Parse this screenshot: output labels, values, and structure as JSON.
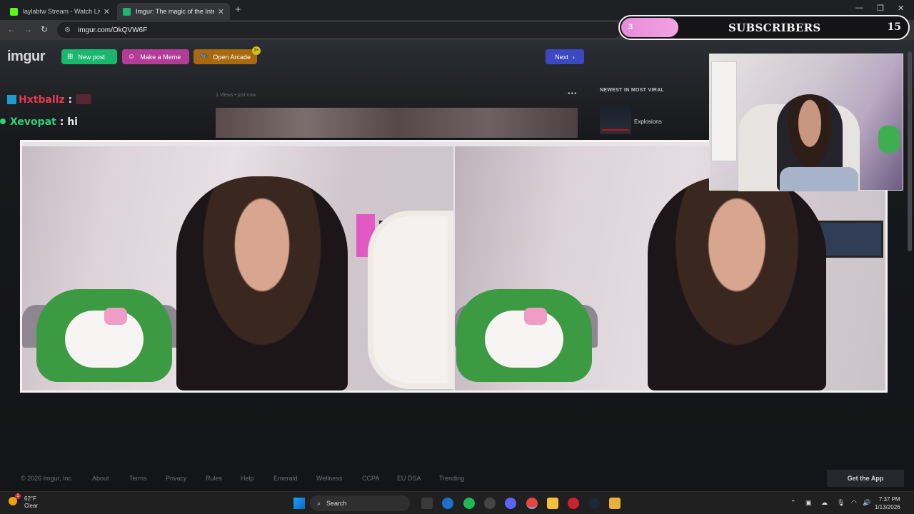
{
  "browser": {
    "tabs": [
      {
        "title": "laylabtw Stream - Watch Live o",
        "favicon_color": "#53fc18"
      },
      {
        "title": "Imgur: The magic of the Intern",
        "favicon_color": "#1bb76e"
      }
    ],
    "new_tab_symbol": "+",
    "close_symbol": "✕",
    "url": "imgur.com/OkQVW6F",
    "window_controls": [
      "—",
      "❐",
      "✕"
    ]
  },
  "imgur": {
    "logo": "imgur",
    "buttons": {
      "new_post": "New post",
      "make_meme": "Make a Meme",
      "open_arcade": "Open Arcade",
      "arcade_badge": "3+",
      "next": "Next"
    },
    "post_meta": "1 Views • just now",
    "more_symbol": "•••",
    "sidebar": {
      "heading": "NEWEST IN MOST VIRAL",
      "item_title": "Explosions"
    },
    "footer_links": [
      "© 2026 Imgur, Inc",
      "About",
      "Terms",
      "Privacy",
      "Rules",
      "Help",
      "Emerald",
      "Wellness",
      "CCPA",
      "EU DSA",
      "Trending"
    ],
    "get_app": "Get the App"
  },
  "stream_overlay": {
    "chat": [
      {
        "user": "Hxtballz",
        "sep": ":",
        "message": "",
        "color": "#e23a56"
      },
      {
        "user": "Xevopat",
        "sep": ":",
        "message": "hi",
        "color": "#2fd07a"
      }
    ],
    "subscribers": {
      "current": "3",
      "label": "SUBSCRIBERS",
      "goal": "15",
      "progress_fraction": 0.2
    }
  },
  "taskbar": {
    "weather_temp": "62°F",
    "weather_desc": "Clear",
    "weather_badge": "1",
    "search_placeholder": "Search",
    "time": "7:37 PM",
    "date": "1/13/2026"
  }
}
